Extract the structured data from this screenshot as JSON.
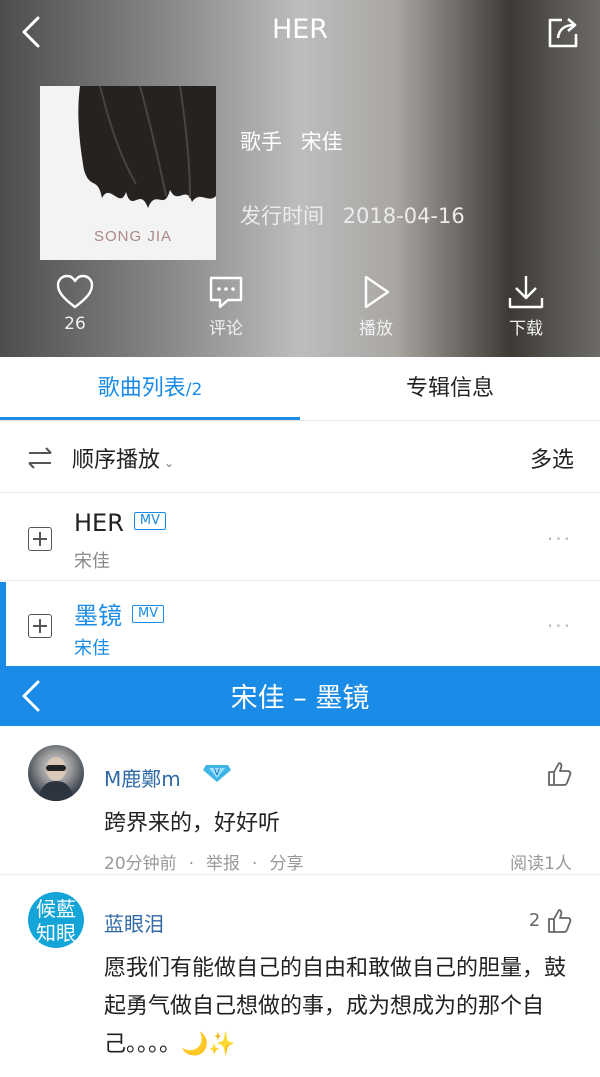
{
  "album": {
    "title": "HER",
    "cover_text": "SONG JIA",
    "singer_label": "歌手",
    "singer": "宋佳",
    "release_label": "发行时间",
    "release_date": "2018-04-16"
  },
  "actions": {
    "like_count": "26",
    "comment": "评论",
    "play": "播放",
    "download": "下载"
  },
  "tabs": {
    "song_list": "歌曲列表",
    "song_count": "/2",
    "album_info": "专辑信息"
  },
  "playmode": {
    "label": "顺序播放",
    "caret": "⌄",
    "multi_select": "多选"
  },
  "songs": [
    {
      "title": "HER",
      "badge": "MV",
      "artist": "宋佳"
    },
    {
      "title": "墨镜",
      "badge": "MV",
      "artist": "宋佳"
    }
  ],
  "comments_panel": {
    "title": "宋佳 – 墨镜"
  },
  "comments": [
    {
      "user": "M鹿鄭m",
      "text": "跨界来的，好好听",
      "time": "20分钟前",
      "report": "举报",
      "share": "分享",
      "sep": "·",
      "reads": "阅读1人",
      "likes": ""
    },
    {
      "user": "蓝眼泪",
      "avatar_text": "候藍 知眼",
      "text": "愿我们有能做自己的自由和敢做自己的胆量，鼓起勇气做自己想做的事，成为想成为的那个自己。。。。🌙✨",
      "likes": "2"
    }
  ],
  "colors": {
    "accent": "#1a8be6",
    "username": "#2f6aa6"
  }
}
